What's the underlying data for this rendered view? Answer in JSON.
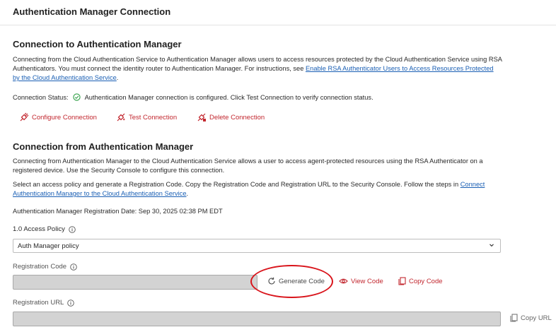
{
  "header": {
    "title": "Authentication Manager Connection"
  },
  "to_am": {
    "title": "Connection to Authentication Manager",
    "description_line1": "Connecting from the Cloud Authentication Service to Authentication Manager allows users to access resources protected by the Cloud Authentication Service using RSA",
    "description_line2_text": "Authenticators. You must connect the identity router to Authentication Manager. For instructions, see ",
    "link_line1": "Enable RSA Authenticator Users to Access Resources Protected",
    "link_line2": "by the Cloud Authentication Service",
    "link_trailing": ".",
    "status_label": "Connection Status:",
    "status_text": "Authentication Manager connection is configured. Click Test Connection to verify connection status.",
    "actions": {
      "configure": "Configure Connection",
      "test": "Test Connection",
      "delete": "Delete Connection"
    }
  },
  "from_am": {
    "title": "Connection from Authentication Manager",
    "description_line1": "Connecting from Authentication Manager to the Cloud Authentication Service allows a user to access agent-protected resources using the RSA Authenticator on a",
    "description_line2": "registered device. Use the Security Console to configure this connection.",
    "steps_line1_text": "Select an access policy and generate a Registration Code. Copy the Registration Code and Registration URL to the Security Console. Follow the steps in ",
    "steps_link_line1": "Connect",
    "steps_link_line2": "Authentication Manager to the Cloud Authentication Service",
    "steps_trailing": ".",
    "registration_date": "Authentication Manager Registration Date: Sep 30, 2025 02:38 PM EDT",
    "policy_label": "1.0 Access Policy",
    "policy_selected": "Auth Manager policy",
    "code_label": "Registration Code",
    "code_value": "",
    "generate_label": "Generate Code",
    "view_label": "View Code",
    "copy_code_label": "Copy Code",
    "url_label": "Registration URL",
    "url_value": "",
    "copy_url_label": "Copy URL"
  },
  "colors": {
    "accent_red": "#c2262e",
    "link_blue": "#1a5fb4",
    "success_green": "#2e9e44",
    "annotation_red": "#d9141b"
  },
  "icons": [
    "plug-icon",
    "plug-test-icon",
    "plug-delete-icon",
    "check-circle-icon",
    "info-icon",
    "chevron-down-icon",
    "refresh-icon",
    "eye-icon",
    "copy-icon"
  ]
}
